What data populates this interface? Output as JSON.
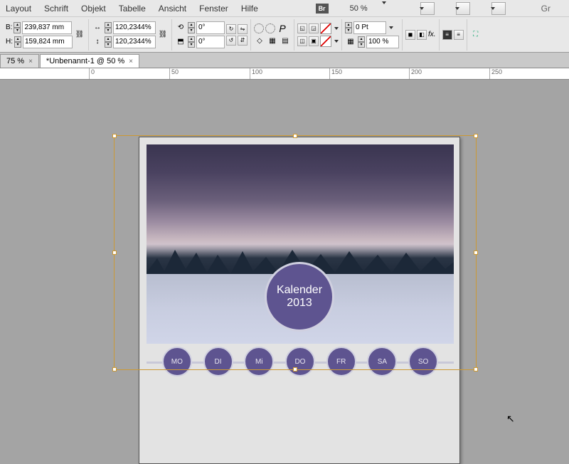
{
  "menu": {
    "items": [
      "Layout",
      "Schrift",
      "Objekt",
      "Tabelle",
      "Ansicht",
      "Fenster",
      "Hilfe"
    ],
    "br_label": "Br",
    "zoom": "50 %",
    "right_text": "Gr"
  },
  "toolbar": {
    "b_label": "B:",
    "b_value": "239,837 mm",
    "h_label": "H:",
    "h_value": "159,824 mm",
    "scale_x": "120,2344%",
    "scale_y": "120,2344%",
    "rot1": "0°",
    "rot2": "0°",
    "p_label": "P",
    "stroke": "0 Pt",
    "opacity": "100 %",
    "fx_label": "fx."
  },
  "tabs": {
    "t1": "75 %",
    "t2": "*Unbenannt-1 @ 50 %"
  },
  "ruler": {
    "marks": [
      "0",
      "50",
      "100",
      "150",
      "200",
      "250"
    ]
  },
  "calendar": {
    "title": "Kalender",
    "year": "2013",
    "days": [
      "MO",
      "DI",
      "Mi",
      "DO",
      "FR",
      "SA",
      "SO"
    ]
  }
}
